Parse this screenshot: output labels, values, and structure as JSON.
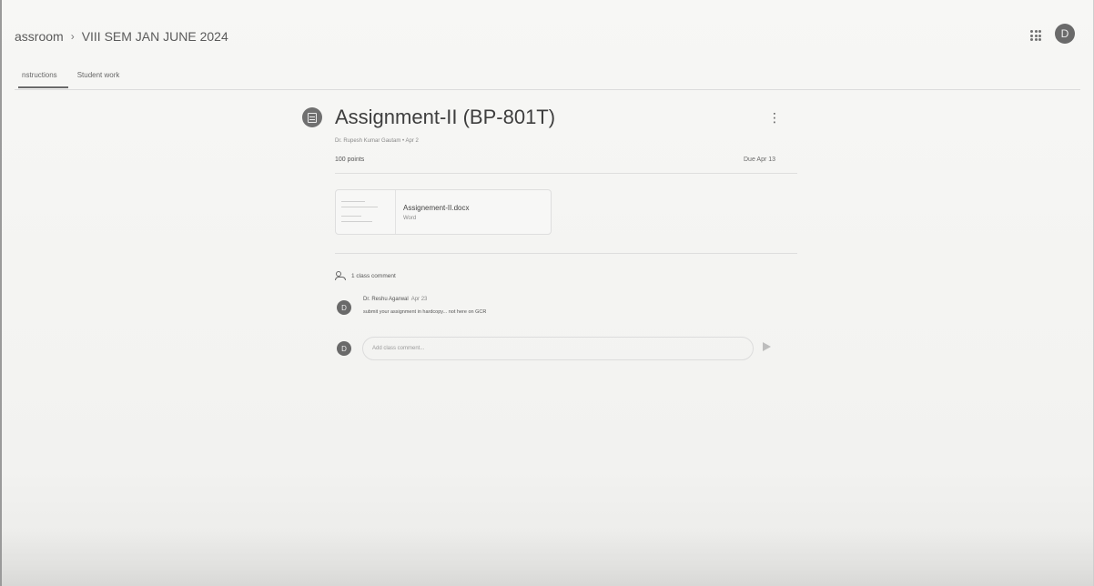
{
  "header": {
    "breadcrumb_root": "assroom",
    "breadcrumb_separator": "›",
    "breadcrumb_class": "VIII SEM JAN JUNE 2024",
    "avatar_letter": "D",
    "icons": [
      "apps-grid-icon",
      "avatar"
    ]
  },
  "tabs": [
    {
      "label": "nstructions",
      "active": true
    },
    {
      "label": "Student work",
      "active": false
    }
  ],
  "assignment": {
    "title": "Assignment-II (BP-801T)",
    "meta": "Dr. Rupesh Kumar Gautam • Apr 2",
    "points": "100 points",
    "due": "Due Apr 13",
    "icon": "assignment-icon"
  },
  "attachment": {
    "name": "Assignement-II.docx",
    "type": "Word"
  },
  "comments": {
    "header": "1 class comment",
    "items": [
      {
        "avatar_letter": "D",
        "author": "Dr. Reshu Agarwal",
        "date": "Apr 23",
        "text": "submit your assignment in hardcopy... not here on GCR"
      }
    ],
    "input_avatar_letter": "D",
    "input_placeholder": "Add class comment..."
  },
  "colors": {
    "background": "#f3f3f1",
    "text": "#4a4a4a",
    "avatar": "#6a6a6a"
  }
}
